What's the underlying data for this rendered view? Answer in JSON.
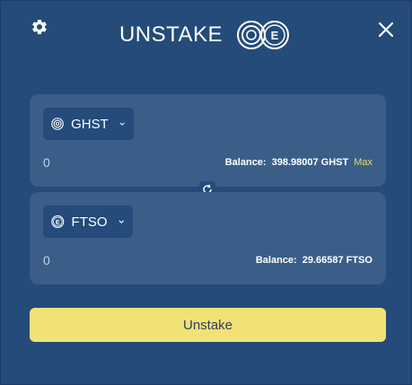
{
  "header": {
    "title": "UNSTAKE",
    "settings_icon": "gear-icon",
    "close_icon": "close-icon",
    "logo_icon": "unstake-logo-icon"
  },
  "from": {
    "token": "GHST",
    "icon": "ghst-token-icon",
    "amount_placeholder": "0",
    "balance_label": "Balance:",
    "balance_value": "398.98007 GHST",
    "max_label": "Max"
  },
  "to": {
    "token": "FTSO",
    "icon": "ftso-token-icon",
    "amount_placeholder": "0",
    "balance_label": "Balance:",
    "balance_value": "29.66587 FTSO"
  },
  "action": {
    "label": "Unstake"
  },
  "colors": {
    "background": "#244b79",
    "panel": "#3b5e89",
    "accent": "#f2e276",
    "max_text": "#e9d76f"
  }
}
